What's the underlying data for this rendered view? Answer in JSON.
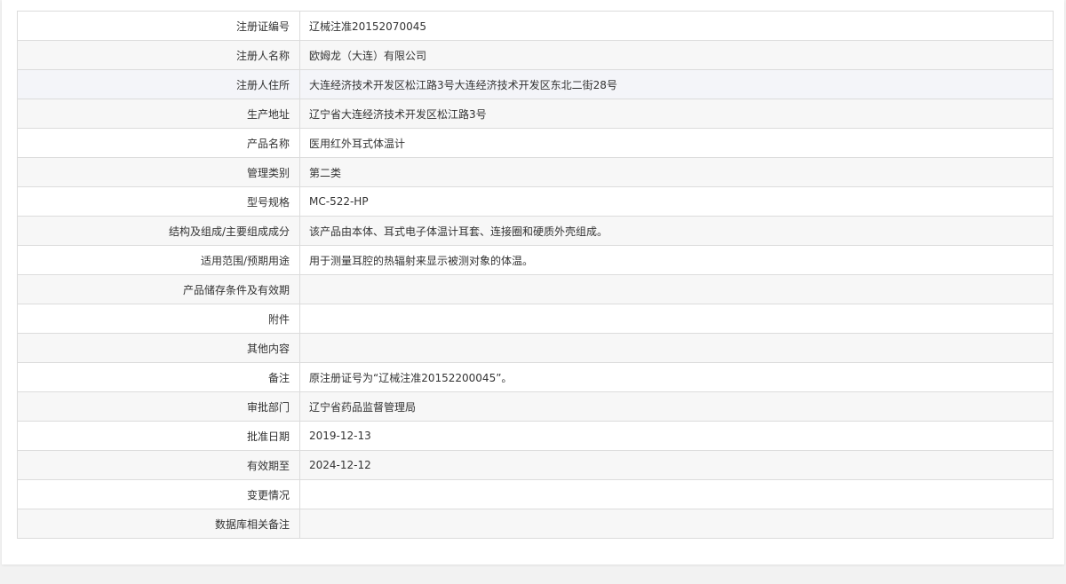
{
  "rows": [
    {
      "label": "注册证编号",
      "value": "辽械注准20152070045"
    },
    {
      "label": "注册人名称",
      "value": "欧姆龙（大连）有限公司"
    },
    {
      "label": "注册人住所",
      "value": "大连经济技术开发区松江路3号大连经济技术开发区东北二街28号"
    },
    {
      "label": "生产地址",
      "value": "辽宁省大连经济技术开发区松江路3号"
    },
    {
      "label": "产品名称",
      "value": "医用红外耳式体温计"
    },
    {
      "label": "管理类别",
      "value": "第二类"
    },
    {
      "label": "型号规格",
      "value": "MC-522-HP"
    },
    {
      "label": "结构及组成/主要组成成分",
      "value": "该产品由本体、耳式电子体温计耳套、连接圈和硬质外壳组成。"
    },
    {
      "label": "适用范围/预期用途",
      "value": "用于测量耳腔的热辐射来显示被测对象的体温。"
    },
    {
      "label": "产品储存条件及有效期",
      "value": ""
    },
    {
      "label": "附件",
      "value": ""
    },
    {
      "label": "其他内容",
      "value": ""
    },
    {
      "label": "备注",
      "value": "原注册证号为“辽械注准20152200045”。"
    },
    {
      "label": "审批部门",
      "value": "辽宁省药品监督管理局"
    },
    {
      "label": "批准日期",
      "value": "2019-12-13"
    },
    {
      "label": "有效期至",
      "value": "2024-12-12"
    },
    {
      "label": "变更情况",
      "value": ""
    },
    {
      "label": "数据库相关备注",
      "value": ""
    }
  ]
}
